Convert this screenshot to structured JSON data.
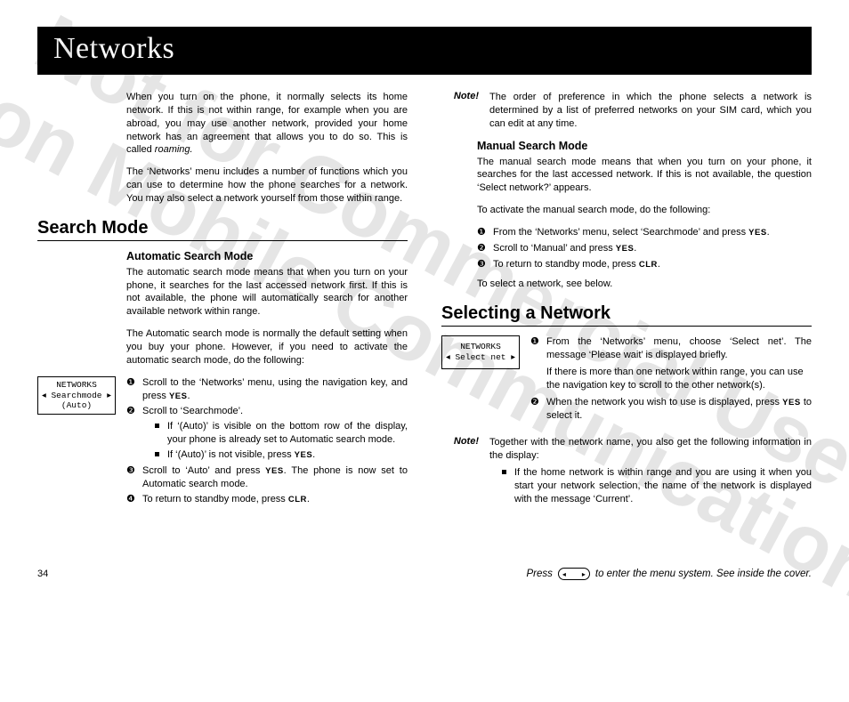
{
  "banner": "Networks",
  "watermark": "Not for Commercial Use\nEricsson Mobile Communications AB",
  "left": {
    "intro1": "When you turn on the phone, it normally selects its home network. If this is not within range, for example when you are abroad, you may use another network, provided your home network has an agreement that allows you to do so. This is called ",
    "intro1_italic": "roaming.",
    "intro2": "The ‘Networks’ menu includes a number of functions which you can use to determine how the phone searches for a network. You may also select a network yourself from those within range.",
    "h2": "Search Mode",
    "h3": "Automatic Search Mode",
    "auto1": "The automatic search mode means that when you turn on your phone, it searches for the last accessed network first. If this is not available, the phone will automatically search for another available network within range.",
    "auto2": "The Automatic search mode is normally the default setting when you buy your phone. However, if you need to activate the automatic search mode, do the following:",
    "display": "NETWORKS\n◂ Searchmode ▸\n(Auto)",
    "steps": {
      "s1a": "Scroll to the ‘Networks’ menu, using the navigation key, and press ",
      "s1key": "YES",
      "s1b": ".",
      "s2": "Scroll to ‘Searchmode’.",
      "s2b1": "If ‘(Auto)’ is visible on the bottom row of the display, your phone is already set to Automatic search mode.",
      "s2b2a": "If ‘(Auto)’ is not visible, press ",
      "s2b2key": "YES",
      "s2b2b": ".",
      "s3a": "Scroll to ‘Auto’ and press ",
      "s3key": "YES",
      "s3b": ". The phone is now set to Automatic search mode.",
      "s4a": "To return to standby mode, press ",
      "s4key": "CLR",
      "s4b": "."
    }
  },
  "right": {
    "note_label": "Note!",
    "note1": "The order of preference in which the phone selects a network is determined by a list of preferred networks on your SIM card, which you can edit at any time.",
    "h3": "Manual Search Mode",
    "man1": "The manual search mode means that when you turn on your phone, it searches for the last accessed network. If this is not available, the question ‘Select network?’ appears.",
    "man2": "To activate the manual search mode, do the following:",
    "msteps": {
      "s1a": "From the ‘Networks’ menu, select ‘Searchmode’ and press ",
      "s1key": "YES",
      "s1b": ".",
      "s2a": "Scroll to ‘Manual’ and press ",
      "s2key": "YES",
      "s2b": ".",
      "s3a": "To return to standby mode, press ",
      "s3key": "CLR",
      "s3b": "."
    },
    "man3": "To select a network, see below.",
    "h2": "Selecting a Network",
    "display2": "NETWORKS\n◂ Select net ▸",
    "sel": {
      "s1": "From the ‘Networks’ menu, choose ‘Select net’. The message ‘Please wait’ is displayed briefly.",
      "s1b": "If there is more than one network within range, you can use the navigation key to scroll to the other network(s).",
      "s2a": "When the network you wish to use is displayed, press ",
      "s2key": "YES",
      "s2b": " to select it."
    },
    "note2": "Together with the network name, you also get the following information in the display:",
    "note2b": "If the home network is within range and you are using it when you start your network selection, the name of the network is displayed with the message ‘Current’."
  },
  "footer": {
    "page": "34",
    "hint_a": "Press",
    "hint_b": "to enter the menu system. See inside the cover."
  }
}
